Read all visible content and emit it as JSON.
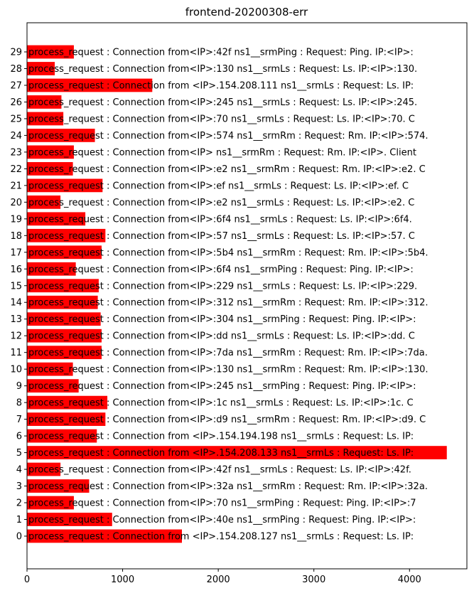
{
  "chart_data": {
    "type": "bar",
    "orientation": "horizontal",
    "title": "frontend-20200308-err",
    "xlabel": "",
    "ylabel": "",
    "xlim": [
      0,
      4600
    ],
    "xticks": [
      0,
      1000,
      2000,
      3000,
      4000
    ],
    "bar_color": "#ff0000",
    "grid": false,
    "categories": [
      "0",
      "1",
      "2",
      "3",
      "4",
      "5",
      "6",
      "7",
      "8",
      "9",
      "10",
      "11",
      "12",
      "13",
      "14",
      "15",
      "16",
      "17",
      "18",
      "19",
      "20",
      "21",
      "22",
      "23",
      "24",
      "25",
      "26",
      "27",
      "28",
      "29"
    ],
    "values": [
      1620,
      890,
      490,
      650,
      350,
      4390,
      730,
      820,
      840,
      540,
      480,
      780,
      780,
      770,
      740,
      750,
      510,
      780,
      820,
      610,
      350,
      790,
      480,
      490,
      710,
      380,
      360,
      1310,
      290,
      490
    ],
    "labels": [
      "process_request : Connection from <IP>.154.208.127 ns1__srmLs : Request: Ls. IP:",
      "process_request : Connection from<IP>:40e ns1__srmPing : Request: Ping. IP:<IP>:",
      "process_request : Connection from<IP>:70 ns1__srmPing : Request: Ping. IP:<IP>:7",
      "process_request : Connection from<IP>:32a ns1__srmRm : Request: Rm. IP:<IP>:32a.",
      "process_request : Connection from<IP>:42f ns1__srmLs : Request: Ls. IP:<IP>:42f.",
      "process_request : Connection from <IP>.154.208.133 ns1__srmLs : Request: Ls. IP:",
      "process_request : Connection from <IP>.154.194.198 ns1__srmLs : Request: Ls. IP:",
      "process_request : Connection from<IP>:d9 ns1__srmRm : Request: Rm. IP:<IP>:d9. C",
      "process_request : Connection from<IP>:1c ns1__srmLs : Request: Ls. IP:<IP>:1c. C",
      "process_request : Connection from<IP>:245 ns1__srmPing : Request: Ping. IP:<IP>:",
      "process_request : Connection from<IP>:130 ns1__srmRm : Request: Rm. IP:<IP>:130.",
      "process_request : Connection from<IP>:7da ns1__srmRm : Request: Rm. IP:<IP>:7da.",
      "process_request : Connection from<IP>:dd ns1__srmLs : Request: Ls. IP:<IP>:dd. C",
      "process_request : Connection from<IP>:304 ns1__srmPing : Request: Ping. IP:<IP>:",
      "process_request : Connection from<IP>:312 ns1__srmRm : Request: Rm. IP:<IP>:312.",
      "process_request : Connection from<IP>:229 ns1__srmLs : Request: Ls. IP:<IP>:229.",
      "process_request : Connection from<IP>:6f4 ns1__srmPing : Request: Ping. IP:<IP>:",
      "process_request : Connection from<IP>:5b4 ns1__srmRm : Request: Rm. IP:<IP>:5b4.",
      "process_request : Connection from<IP>:57 ns1__srmLs : Request: Ls. IP:<IP>:57. C",
      "process_request : Connection from<IP>:6f4 ns1__srmLs : Request: Ls. IP:<IP>:6f4.",
      "process_request : Connection from<IP>:e2 ns1__srmLs : Request: Ls. IP:<IP>:e2. C",
      "process_request : Connection from<IP>:ef ns1__srmLs : Request: Ls. IP:<IP>:ef. C",
      "process_request : Connection from<IP>:e2 ns1__srmRm : Request: Rm. IP:<IP>:e2. C",
      "process_request : Connection from<IP> ns1__srmRm : Request: Rm. IP:<IP>. Client",
      "process_request : Connection from<IP>:574 ns1__srmRm : Request: Rm. IP:<IP>:574.",
      "process_request : Connection from<IP>:70 ns1__srmLs : Request: Ls. IP:<IP>:70. C",
      "process_request : Connection from<IP>:245 ns1__srmLs : Request: Ls. IP:<IP>:245.",
      "process_request : Connection from <IP>.154.208.111 ns1__srmLs : Request: Ls. IP:",
      "process_request : Connection from<IP>:130 ns1__srmLs : Request: Ls. IP:<IP>:130.",
      "process_request : Connection from<IP>:42f ns1__srmPing : Request: Ping. IP:<IP>:"
    ]
  }
}
